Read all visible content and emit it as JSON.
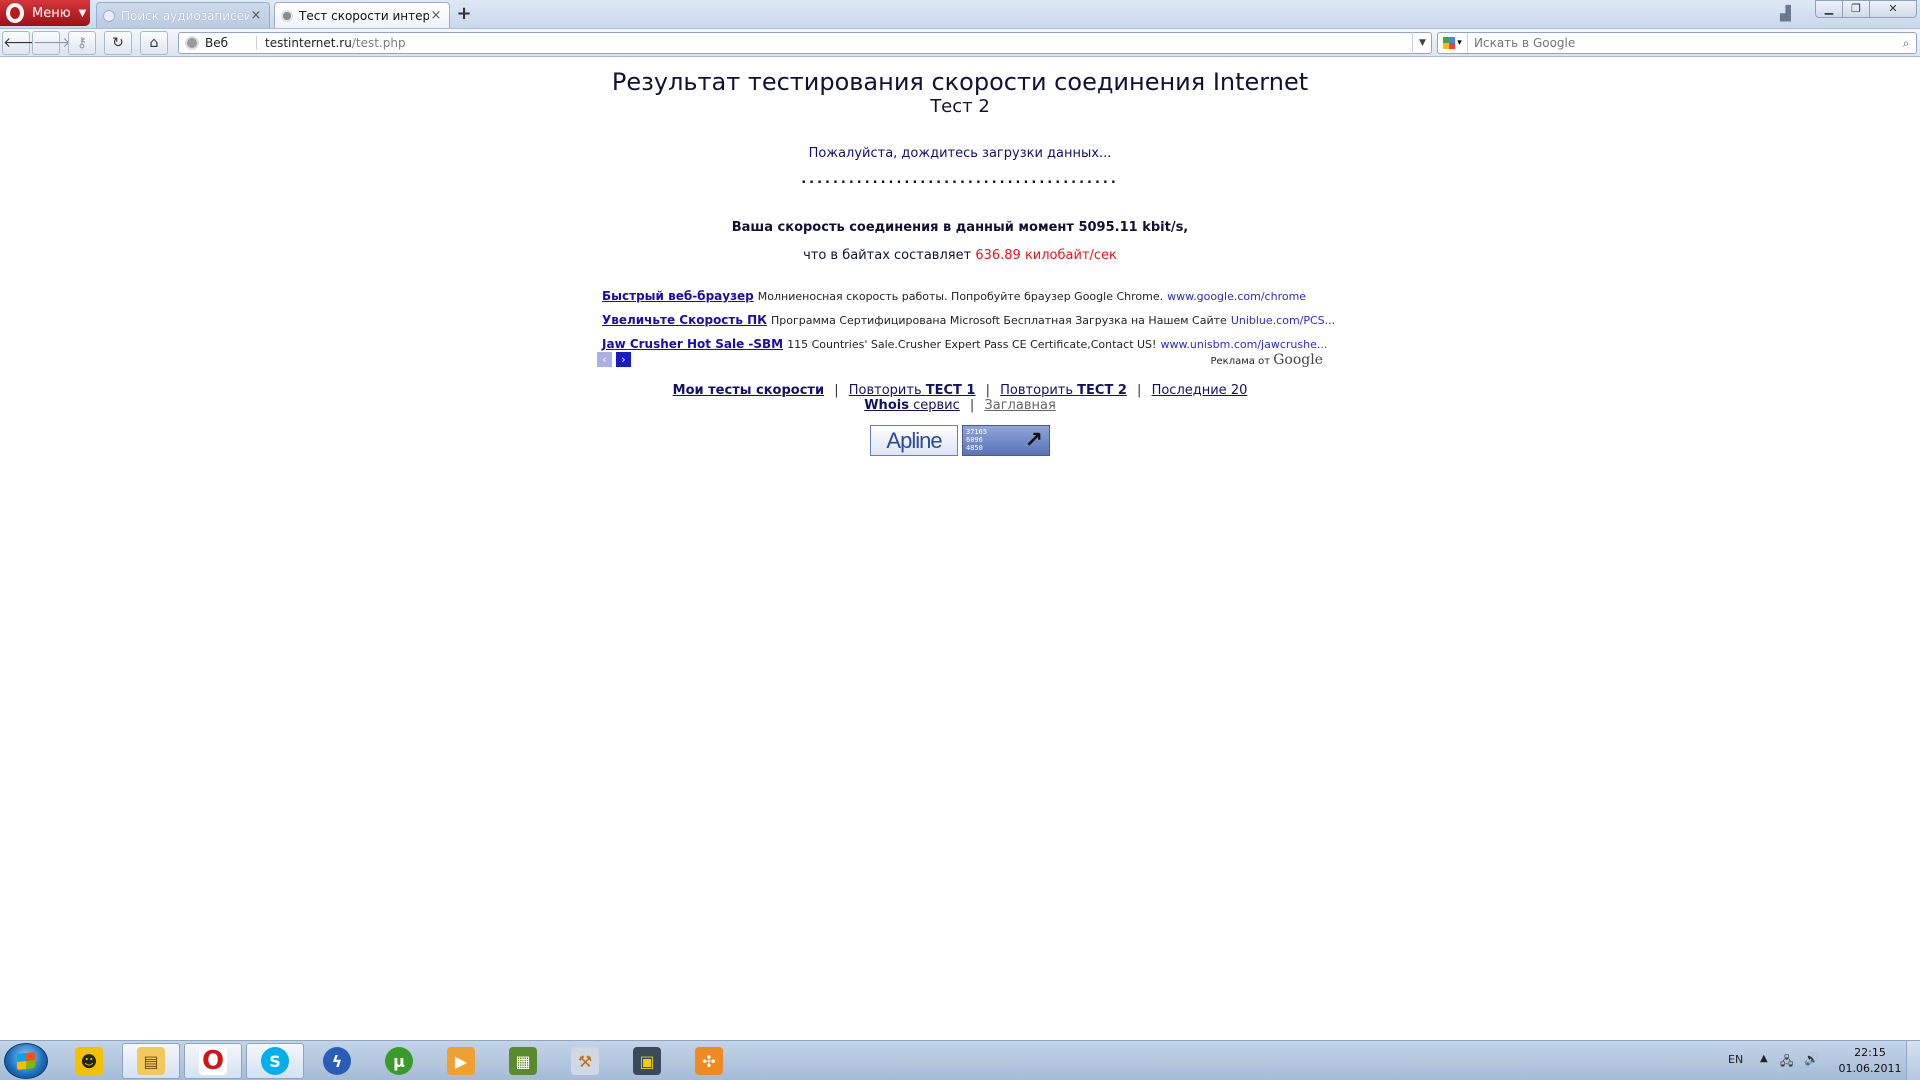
{
  "browser": {
    "menu_label": "Меню",
    "tabs": [
      {
        "label": "Поиск аудиозаписей..."
      },
      {
        "label": "Тест скорости интер..."
      }
    ],
    "tab_close": "×",
    "new_tab": "+",
    "address": {
      "site_label": "Веб",
      "host": "testinternet.ru",
      "path": "/test.php"
    },
    "search": {
      "placeholder": "Искать в Google"
    }
  },
  "page": {
    "title": "Результат тестирования скорости соединения Internet",
    "subtitle": "Тест 2",
    "wait_message": "Пожалуйста, дождитесь загрузки данных...",
    "progress_dots": "........................................",
    "speed_text": "Ваша скорость соединения в данный момент 5095.11 kbit/s,",
    "bytes_prefix": "что в байтах составляет",
    "bytes_value": "636.89 килобайт/сек",
    "ads": [
      {
        "headline": "Быстрый веб-браузер",
        "text": "Молниеносная скорость работы. Попробуйте браузер Google Chrome.",
        "url": "www.google.com/chrome"
      },
      {
        "headline": "Увеличьте Скорость ПК",
        "text": "Программа Сертифицирована Microsoft Бесплатная Загрузка на Нашем Сайте",
        "url": "Uniblue.com/PCS..."
      },
      {
        "headline": "Jaw Crusher Hot Sale -SBM",
        "text": "115 Countries' Sale.Crusher Expert Pass CE Certificate,Contact US!",
        "url": "www.unisbm.com/jawcrushe..."
      }
    ],
    "ads_by_prefix": "Реклама от",
    "ads_by_brand": "Google",
    "nav_links": {
      "my_tests": "Мои тесты скорости",
      "repeat_test1_prefix": "Повторить",
      "repeat_test1_bold": "ТЕСТ 1",
      "repeat_test2_prefix": "Повторить",
      "repeat_test2_bold": "ТЕСТ 2",
      "last20": "Последние 20",
      "whois_bold": "Whois",
      "whois_rest": "сервис",
      "home": "Заглавная",
      "separator": "|"
    },
    "badge_apline": "Apline",
    "counter_values": [
      "37165",
      "6096",
      "4850"
    ]
  },
  "taskbar": {
    "lang": "EN",
    "time": "22:15",
    "date": "01.06.2011"
  },
  "colors": {
    "accent_red": "#e8141e",
    "link_blue": "#1a0dab",
    "text_navy": "#111133"
  }
}
